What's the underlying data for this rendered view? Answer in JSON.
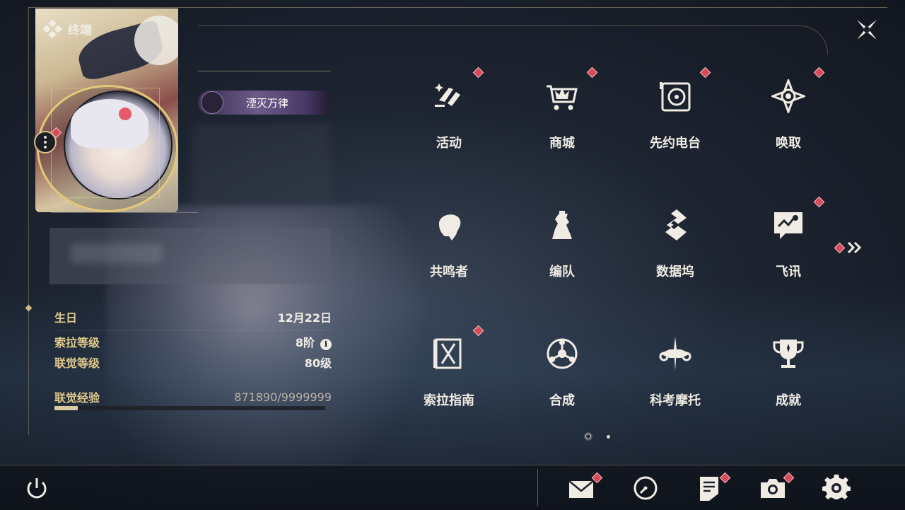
{
  "header": {
    "title": "终端"
  },
  "profile": {
    "title_badge": "湮灭万律",
    "stats": [
      {
        "label": "生日",
        "value": "12月22日"
      },
      {
        "label": "索拉等级",
        "value": "8阶"
      },
      {
        "label": "联觉等级",
        "value": "80级"
      }
    ],
    "exp": {
      "label": "联觉经验",
      "value": "871890/9999999",
      "progress_fraction": 0.087
    }
  },
  "menu": {
    "items": [
      {
        "label": "活动",
        "icon": "activity-icon",
        "badge": true
      },
      {
        "label": "商城",
        "icon": "shop-cart-icon",
        "badge": true
      },
      {
        "label": "先约电台",
        "icon": "radio-icon",
        "badge": true
      },
      {
        "label": "唤取",
        "icon": "summon-compass-icon",
        "badge": true
      },
      {
        "label": "共鸣者",
        "icon": "resonator-head-icon",
        "badge": false
      },
      {
        "label": "编队",
        "icon": "team-chess-icon",
        "badge": false
      },
      {
        "label": "数据坞",
        "icon": "data-bank-icon",
        "badge": false
      },
      {
        "label": "飞讯",
        "icon": "chat-message-icon",
        "badge": true
      },
      {
        "label": "索拉指南",
        "icon": "guide-book-icon",
        "badge": true
      },
      {
        "label": "合成",
        "icon": "synthesis-icon",
        "badge": false
      },
      {
        "label": "科考摩托",
        "icon": "motorbike-icon",
        "badge": false
      },
      {
        "label": "成就",
        "icon": "trophy-icon",
        "badge": false
      }
    ],
    "pages": 2,
    "current_page": 1
  },
  "bottom_bar": {
    "left_icon": "power-icon",
    "right_icons": [
      "mail-icon",
      "clock-icon",
      "notes-icon",
      "camera-icon",
      "settings-gear-icon"
    ]
  },
  "colors": {
    "accent_gold": "#e0c98a",
    "badge_red": "#d94a58",
    "text": "#f0ece4"
  }
}
